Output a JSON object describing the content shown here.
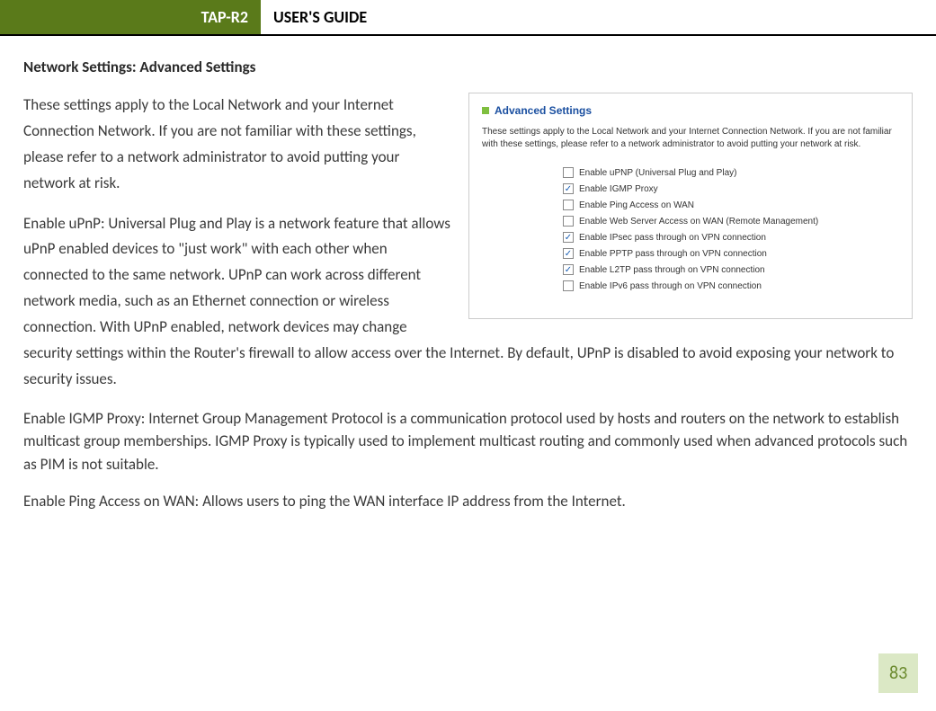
{
  "header": {
    "model": "TAP-R2",
    "title": "USER'S GUIDE"
  },
  "section_title": "Network Settings: Advanced Settings",
  "paragraphs": {
    "intro": "These settings apply to the Local Network and your Internet Connection Network.  If you are not familiar with these settings, please refer to a network administrator to avoid putting your network at risk.",
    "upnp": "Enable uPnP: Universal Plug and Play is a network feature that allows uPnP enabled devices to \"just work\" with each other when connected to the same network.  UPnP can work across different network media, such as an Ethernet connection or wireless connection.  With UPnP enabled, network devices may change security settings within the Router's firewall to allow access over the Internet.  By default, UPnP is disabled to avoid exposing your network to security issues.",
    "igmp": "Enable IGMP Proxy: Internet Group Management Protocol is a communication protocol used by hosts and routers on the network to establish multicast group memberships.  IGMP Proxy is typically used to implement multicast routing and commonly used when advanced protocols such as PIM is not suitable.",
    "ping": "Enable Ping Access on WAN: Allows users to ping the WAN interface IP address from the Internet."
  },
  "figure": {
    "title": "Advanced Settings",
    "desc": "These settings apply to the Local Network and your Internet Connection Network.  If you are not familiar with these settings, please refer to a network administrator to avoid putting your network at risk.",
    "items": [
      {
        "label": "Enable uPNP (Universal Plug and Play)",
        "checked": false
      },
      {
        "label": "Enable IGMP Proxy",
        "checked": true
      },
      {
        "label": "Enable Ping Access on WAN",
        "checked": false
      },
      {
        "label": "Enable Web Server Access on WAN (Remote Management)",
        "checked": false
      },
      {
        "label": "Enable IPsec pass through on VPN connection",
        "checked": true
      },
      {
        "label": "Enable PPTP pass through on VPN connection",
        "checked": true
      },
      {
        "label": "Enable L2TP pass through on VPN connection",
        "checked": true
      },
      {
        "label": "Enable IPv6 pass through on VPN connection",
        "checked": false
      }
    ]
  },
  "page_number": "83"
}
